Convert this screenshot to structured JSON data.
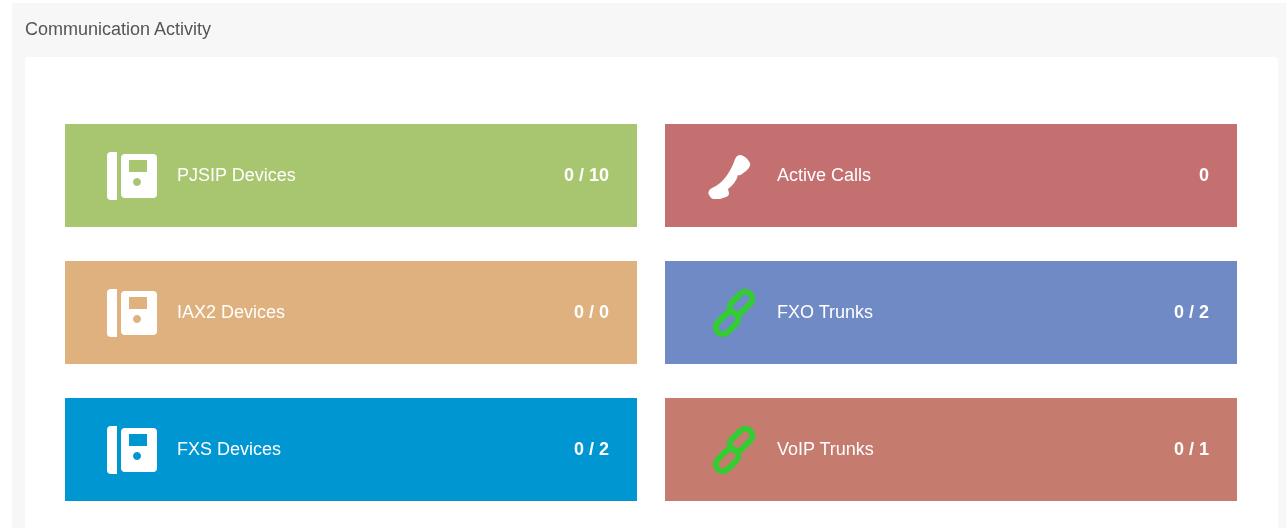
{
  "panel": {
    "title": "Communication Activity"
  },
  "tiles": [
    {
      "kind": "desk-phone",
      "label": "PJSIP Devices",
      "value": "0 / 10",
      "color": "#a8c66f"
    },
    {
      "kind": "handset",
      "label": "Active Calls",
      "value": "0",
      "color": "#c57070"
    },
    {
      "kind": "desk-phone",
      "label": "IAX2 Devices",
      "value": "0 / 0",
      "color": "#dfb17f"
    },
    {
      "kind": "link",
      "label": "FXO Trunks",
      "value": "0 / 2",
      "color": "#6f8ac5"
    },
    {
      "kind": "desk-phone",
      "label": "FXS Devices",
      "value": "0 / 2",
      "color": "#0096d2"
    },
    {
      "kind": "link",
      "label": "VoIP Trunks",
      "value": "0 / 1",
      "color": "#c57b6e"
    }
  ]
}
